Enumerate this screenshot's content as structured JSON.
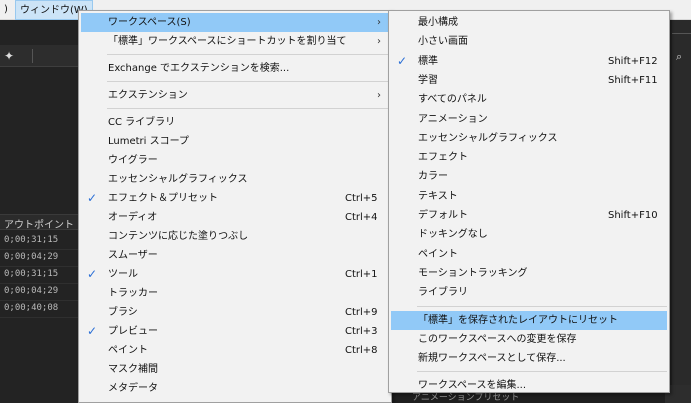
{
  "menubar": {
    "items": [
      {
        "label": ")"
      },
      {
        "label": "ウィンドウ(W)"
      }
    ]
  },
  "timeline": {
    "header": "アウトポイント",
    "rows": [
      "0;00;31;15",
      "0;00;04;29",
      "0;00;31;15",
      "0;00;04;29",
      "0;00;40;08"
    ]
  },
  "bottom_fragment": "アニメーションプリセット",
  "window_menu": {
    "items": [
      {
        "label": "ワークスペース(S)",
        "arrow": "›",
        "highlight": true
      },
      {
        "label": "「標準」ワークスペースにショートカットを割り当て",
        "arrow": "›"
      },
      {
        "separator": true
      },
      {
        "label": "Exchange でエクステンションを検索..."
      },
      {
        "separator": true
      },
      {
        "label": "エクステンション",
        "arrow": "›"
      },
      {
        "separator": true
      },
      {
        "label": "CC ライブラリ"
      },
      {
        "label": "Lumetri スコープ"
      },
      {
        "label": "ウイグラー"
      },
      {
        "label": "エッセンシャルグラフィックス"
      },
      {
        "label": "エフェクト＆プリセット",
        "shortcut": "Ctrl+5",
        "checked": true
      },
      {
        "label": "オーディオ",
        "shortcut": "Ctrl+4"
      },
      {
        "label": "コンテンツに応じた塗りつぶし"
      },
      {
        "label": "スムーザー"
      },
      {
        "label": "ツール",
        "shortcut": "Ctrl+1",
        "checked": true
      },
      {
        "label": "トラッカー"
      },
      {
        "label": "ブラシ",
        "shortcut": "Ctrl+9"
      },
      {
        "label": "プレビュー",
        "shortcut": "Ctrl+3",
        "checked": true
      },
      {
        "label": "ペイント",
        "shortcut": "Ctrl+8"
      },
      {
        "label": "マスク補間"
      },
      {
        "label": "メタデータ"
      }
    ]
  },
  "workspace_submenu": {
    "items": [
      {
        "label": "最小構成"
      },
      {
        "label": "小さい画面"
      },
      {
        "label": "標準",
        "shortcut": "Shift+F12",
        "checked": true
      },
      {
        "label": "学習",
        "shortcut": "Shift+F11"
      },
      {
        "label": "すべてのパネル"
      },
      {
        "label": "アニメーション"
      },
      {
        "label": "エッセンシャルグラフィックス"
      },
      {
        "label": "エフェクト"
      },
      {
        "label": "カラー"
      },
      {
        "label": "テキスト"
      },
      {
        "label": "デフォルト",
        "shortcut": "Shift+F10"
      },
      {
        "label": "ドッキングなし"
      },
      {
        "label": "ペイント"
      },
      {
        "label": "モーショントラッキング"
      },
      {
        "label": "ライブラリ"
      },
      {
        "separator": true
      },
      {
        "label": "「標準」を保存されたレイアウトにリセット",
        "highlight": true
      },
      {
        "label": "このワークスペースへの変更を保存"
      },
      {
        "label": "新規ワークスペースとして保存..."
      },
      {
        "separator": true
      },
      {
        "label": "ワークスペースを編集..."
      }
    ]
  },
  "colors": {
    "highlight": "#91c9f7",
    "checkmark": "#2b6fd6",
    "menu_bg": "#f2f2f2",
    "app_bg": "#232323"
  }
}
